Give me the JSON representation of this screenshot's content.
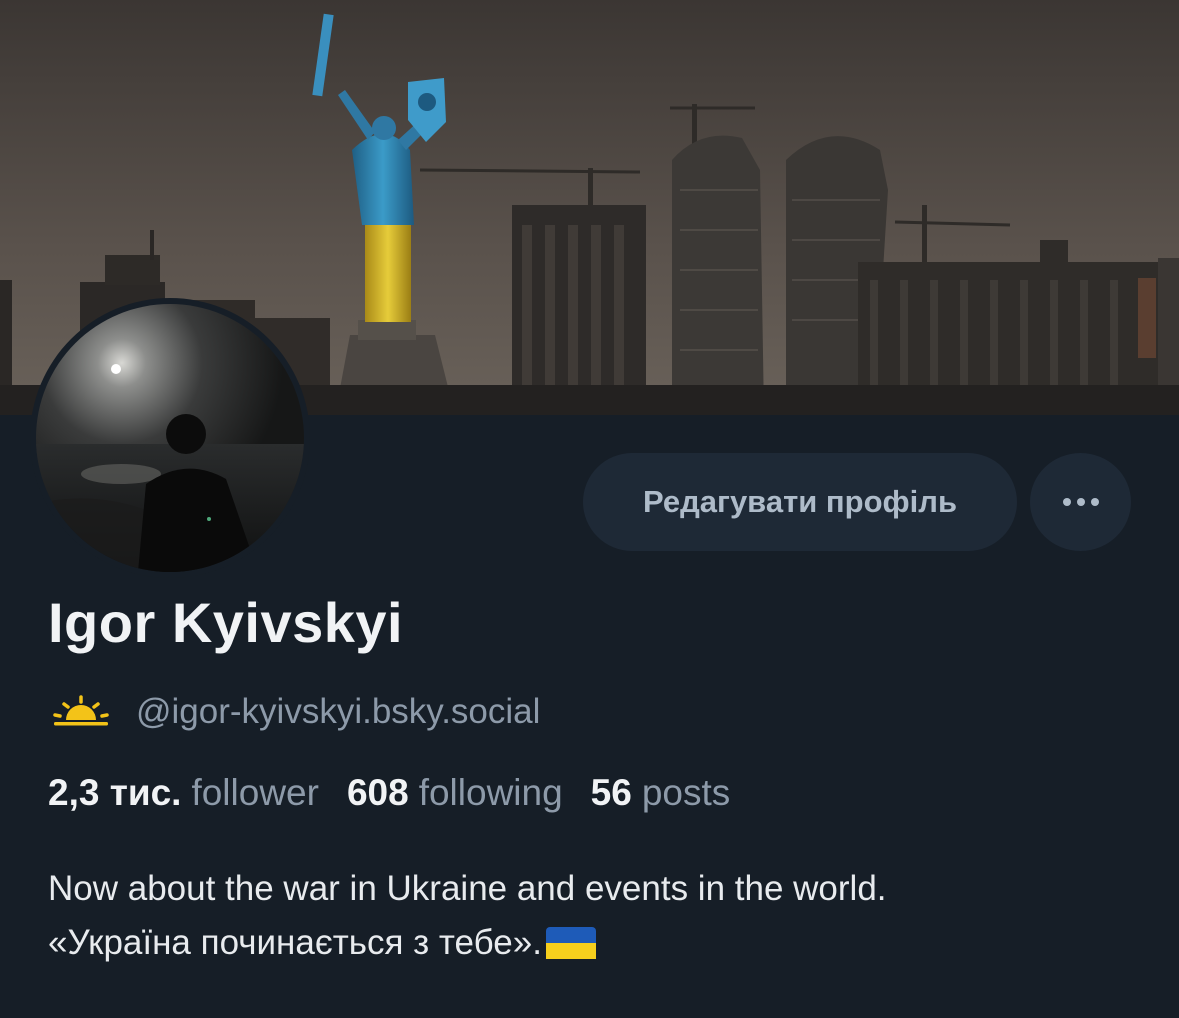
{
  "profile": {
    "display_name": "Igor Kyivskyi",
    "handle": "@igor-kyivskyi.bsky.social",
    "handle_icon": "sunrise-icon",
    "stats": {
      "followers_count": "2,3 тис.",
      "followers_label": "follower",
      "following_count": "608",
      "following_label": "following",
      "posts_count": "56",
      "posts_label": "posts"
    },
    "bio": {
      "line1": "Now about the war in Ukraine and events in the world.",
      "line2": "«Україна починається з тебе».",
      "line2_emoji": "ukraine-flag-icon"
    }
  },
  "actions": {
    "edit_label": "Редагувати профіль",
    "more_icon": "more-horizontal-icon"
  },
  "colors": {
    "background": "#161e27",
    "button_bg": "#1e2936",
    "muted_text": "#8d9aa9",
    "primary_text": "#f1f3f5",
    "flag_blue": "#1e5bb8",
    "flag_yellow": "#f6cf1d"
  }
}
